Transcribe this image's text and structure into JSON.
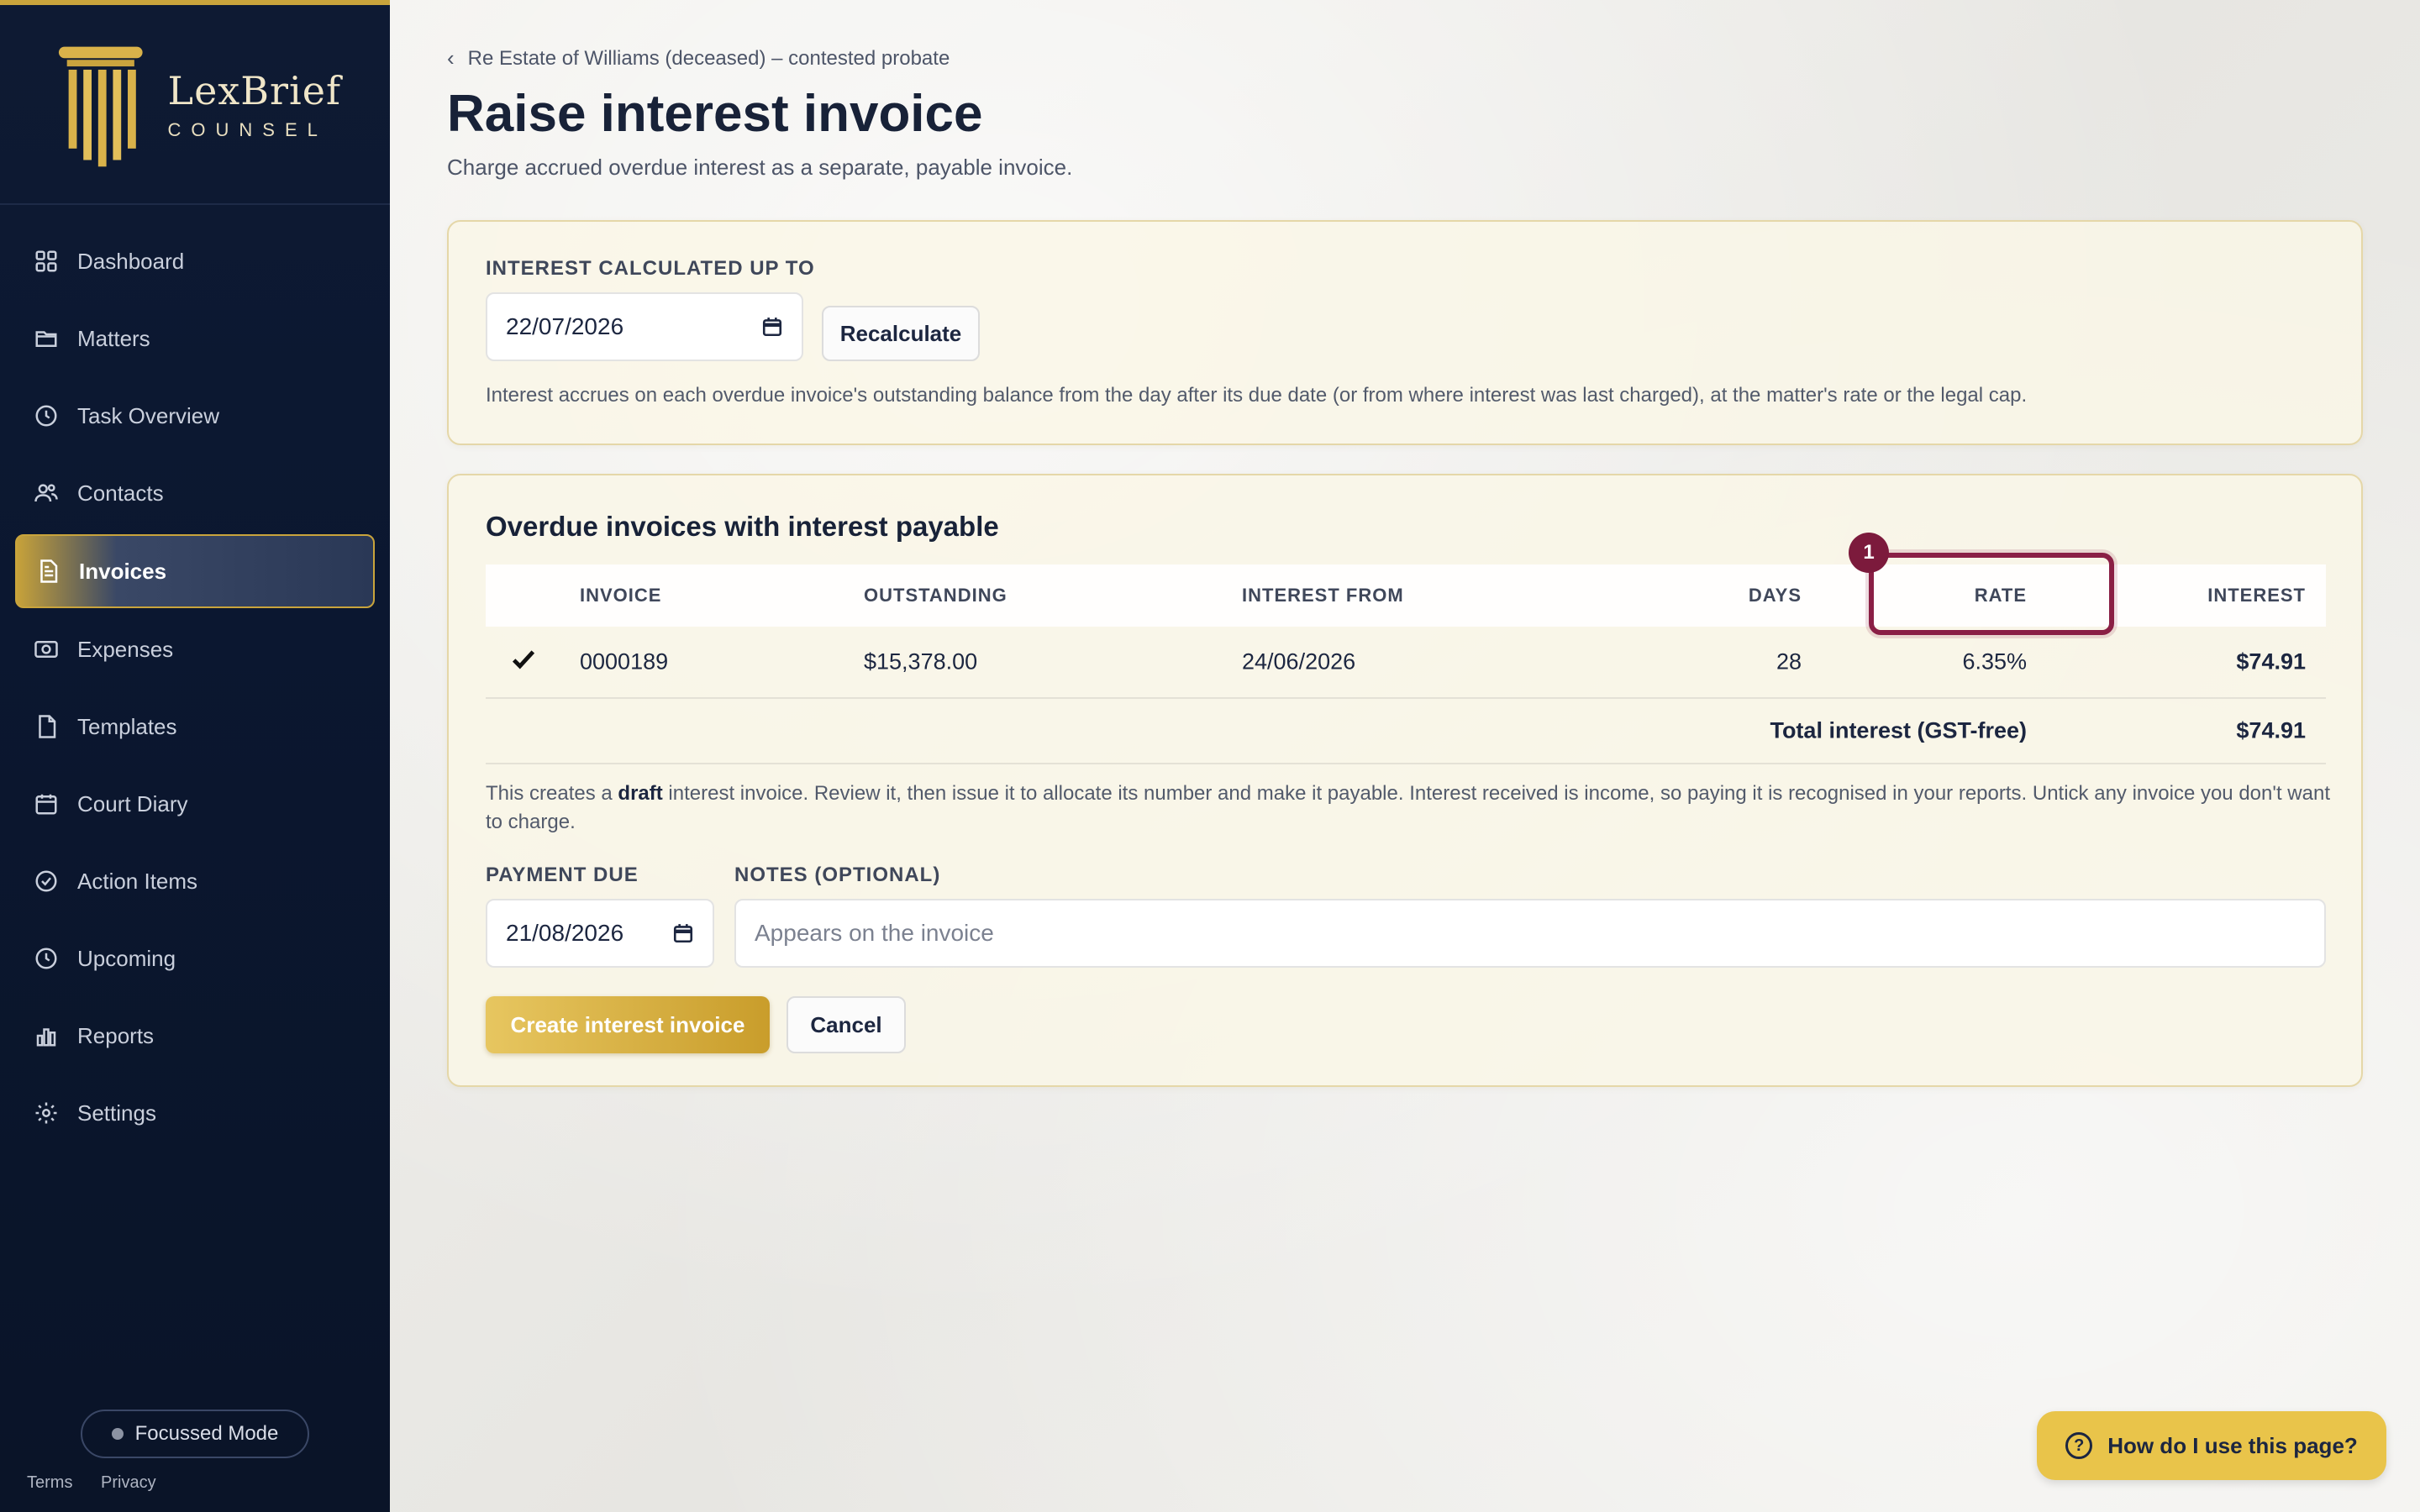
{
  "brand": {
    "name": "LexBrief",
    "sub": "COUNSEL"
  },
  "nav": [
    {
      "label": "Dashboard",
      "icon": "grid-icon"
    },
    {
      "label": "Matters",
      "icon": "folder-icon"
    },
    {
      "label": "Task Overview",
      "icon": "clock-icon"
    },
    {
      "label": "Contacts",
      "icon": "people-icon"
    },
    {
      "label": "Invoices",
      "icon": "document-icon",
      "active": true
    },
    {
      "label": "Expenses",
      "icon": "camera-icon"
    },
    {
      "label": "Templates",
      "icon": "file-icon"
    },
    {
      "label": "Court Diary",
      "icon": "calendar-icon"
    },
    {
      "label": "Action Items",
      "icon": "check-circle-icon"
    },
    {
      "label": "Upcoming",
      "icon": "clock-icon"
    },
    {
      "label": "Reports",
      "icon": "bar-chart-icon"
    },
    {
      "label": "Settings",
      "icon": "gear-icon"
    }
  ],
  "focus_mode": "Focussed Mode",
  "footer": {
    "terms": "Terms",
    "privacy": "Privacy"
  },
  "breadcrumb": "Re Estate of Williams (deceased) – contested probate",
  "page": {
    "title": "Raise interest invoice",
    "subtitle": "Charge accrued overdue interest as a separate, payable invoice."
  },
  "calc": {
    "label": "INTEREST CALCULATED UP TO",
    "date": "22/07/2026",
    "recalculate": "Recalculate",
    "helper": "Interest accrues on each overdue invoice's outstanding balance from the day after its due date (or from where interest was last charged), at the matter's rate or the legal cap."
  },
  "overdue": {
    "title": "Overdue invoices with interest payable",
    "headers": {
      "invoice": "INVOICE",
      "outstanding": "OUTSTANDING",
      "interest_from": "INTEREST FROM",
      "days": "DAYS",
      "rate": "RATE",
      "interest": "INTEREST"
    },
    "rows": [
      {
        "invoice": "0000189",
        "outstanding": "$15,378.00",
        "interest_from": "24/06/2026",
        "days": "28",
        "rate": "6.35%",
        "interest": "$74.91",
        "checked": true
      }
    ],
    "total_label": "Total interest (GST-free)",
    "total_value": "$74.91",
    "note_pre": "This creates a ",
    "note_bold": "draft",
    "note_post": " interest invoice. Review it, then issue it to allocate its number and make it payable. Interest received is income, so paying it is recognised in your reports. Untick any invoice you don't want to charge.",
    "payment_due_label": "PAYMENT DUE",
    "payment_due": "21/08/2026",
    "notes_label": "NOTES (OPTIONAL)",
    "notes_placeholder": "Appears on the invoice",
    "create": "Create interest invoice",
    "cancel": "Cancel",
    "badge": "1"
  },
  "help": "How do I use this page?"
}
